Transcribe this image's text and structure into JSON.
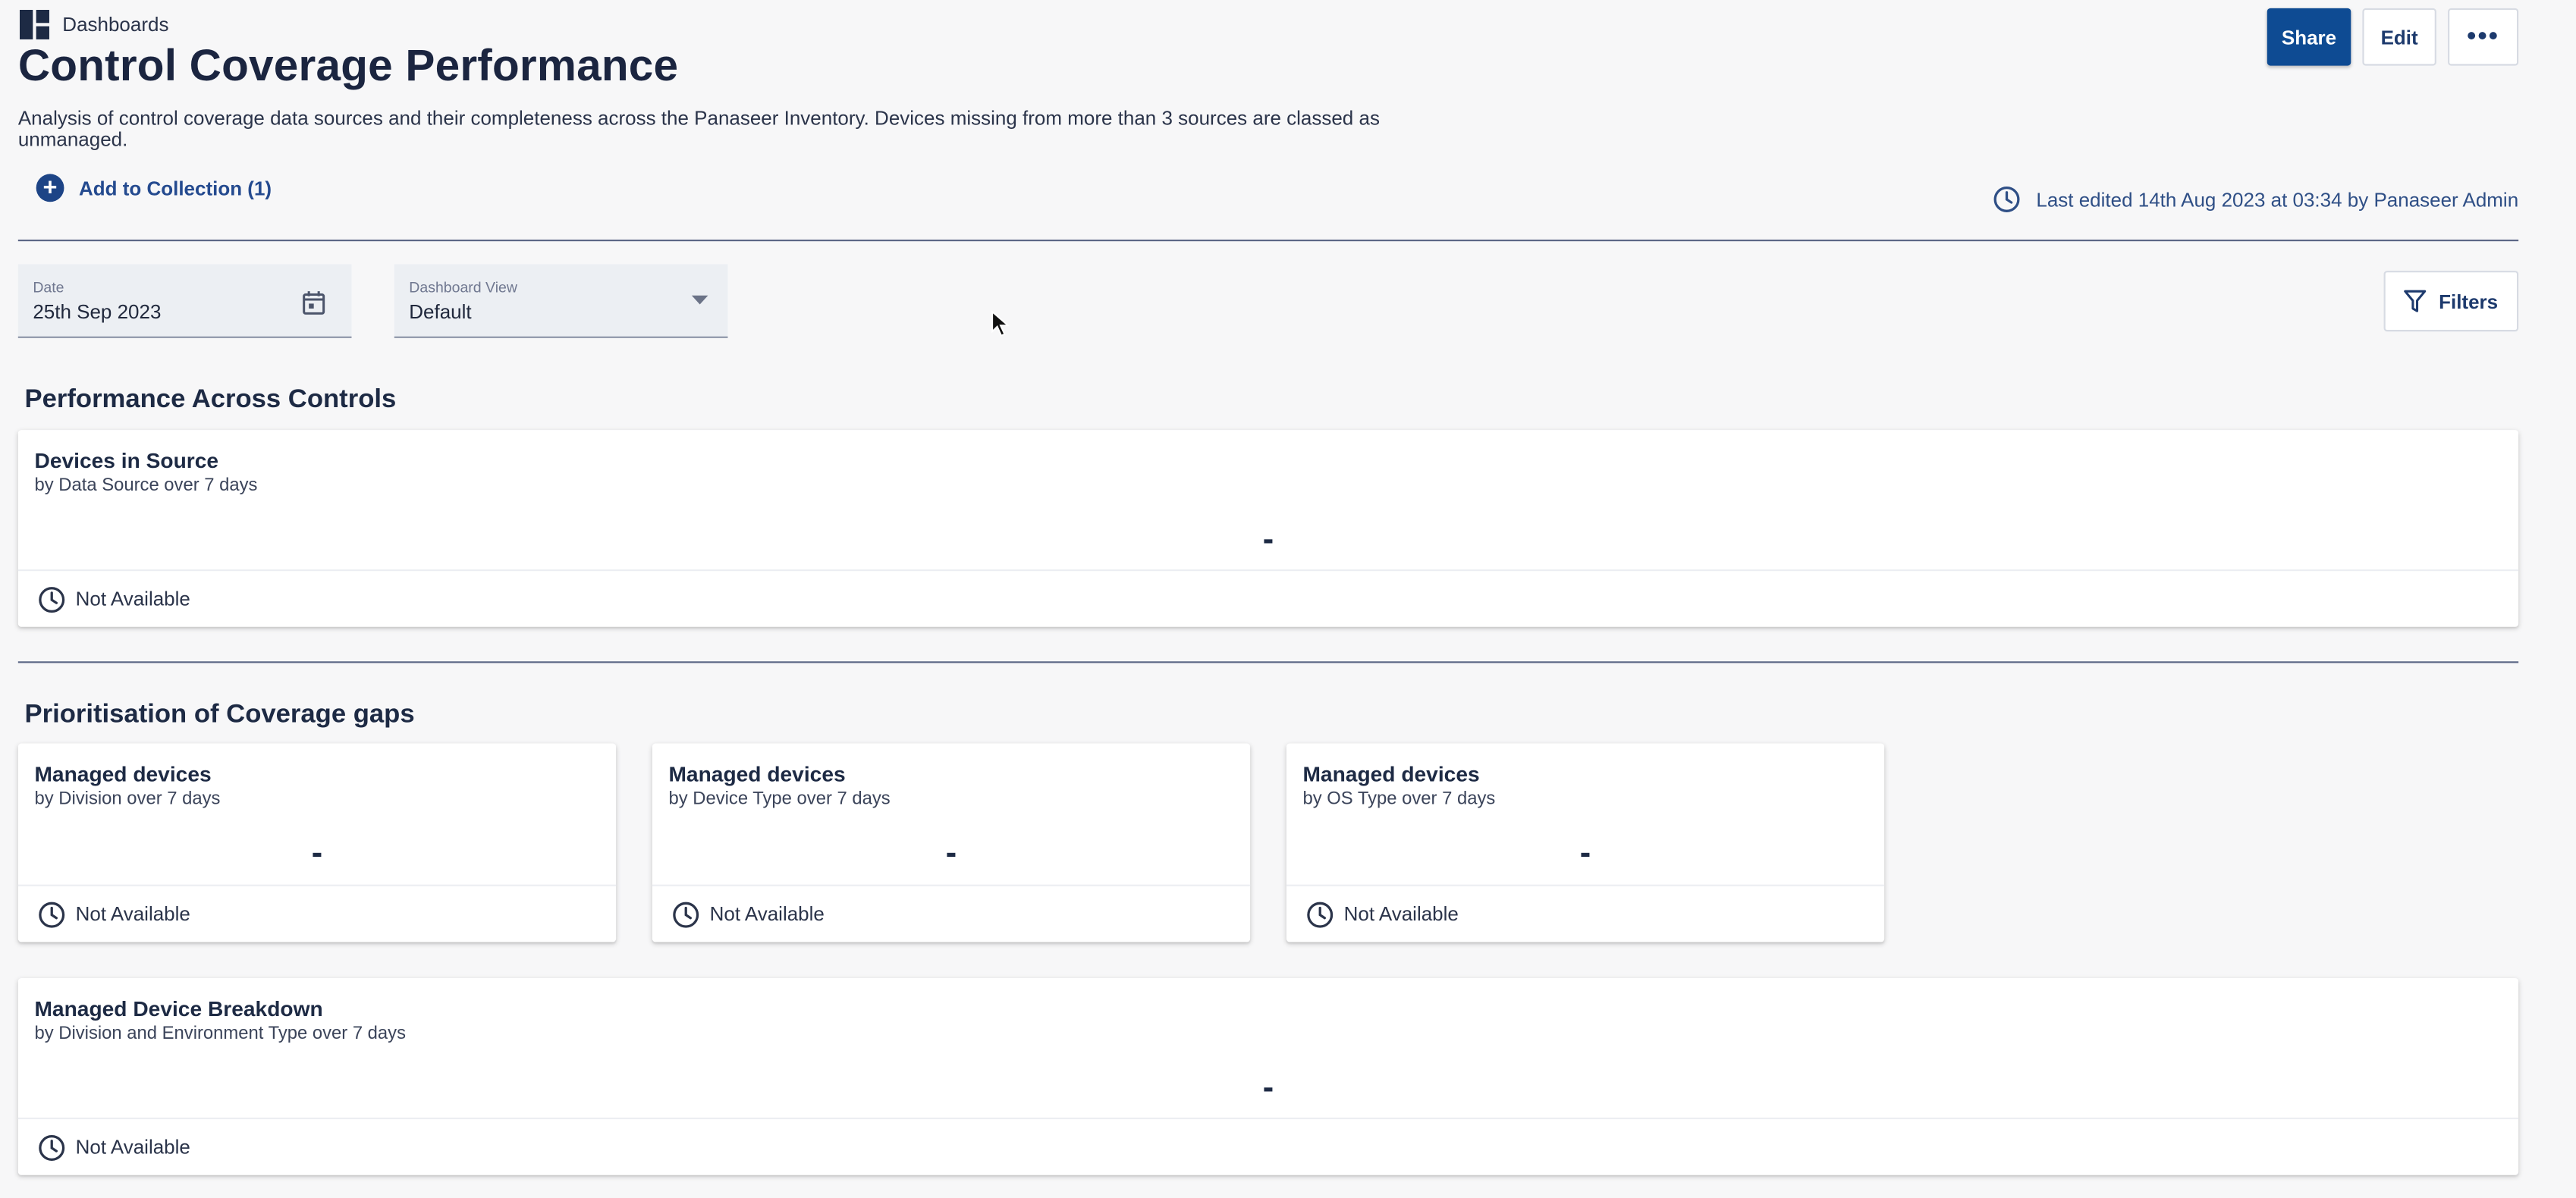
{
  "breadcrumb": {
    "label": "Dashboards"
  },
  "page": {
    "title": "Control Coverage Performance",
    "description": "Analysis of control coverage data sources and their completeness across the Panaseer Inventory. Devices missing from more than 3 sources are classed as unmanaged."
  },
  "actions": {
    "share_label": "Share",
    "edit_label": "Edit",
    "more_label": "•••"
  },
  "collection": {
    "label": "Add to Collection (1)"
  },
  "last_edited": {
    "text": "Last edited 14th Aug 2023 at 03:34 by Panaseer Admin"
  },
  "filters": {
    "date": {
      "label": "Date",
      "value": "25th Sep 2023"
    },
    "view": {
      "label": "Dashboard View",
      "value": "Default"
    },
    "filters_label": "Filters"
  },
  "sections": {
    "performance": {
      "title": "Performance Across Controls",
      "cards": [
        {
          "title": "Devices in Source",
          "subtitle": "by Data Source over 7 days",
          "value": "-",
          "status": "Not Available"
        }
      ]
    },
    "prioritisation": {
      "title": "Prioritisation of Coverage gaps",
      "cards": [
        {
          "title": "Managed devices",
          "subtitle": "by Division over 7 days",
          "value": "-",
          "status": "Not Available"
        },
        {
          "title": "Managed devices",
          "subtitle": "by Device Type over 7 days",
          "value": "-",
          "status": "Not Available"
        },
        {
          "title": "Managed devices",
          "subtitle": "by OS Type over 7 days",
          "value": "-",
          "status": "Not Available"
        },
        {
          "title": "Managed Device Breakdown",
          "subtitle": "by Division and Environment Type over 7 days",
          "value": "-",
          "status": "Not Available"
        }
      ]
    }
  },
  "colors": {
    "primary": "#0e4b93",
    "accent_link": "#244a8f",
    "background": "#f7f7f8"
  }
}
